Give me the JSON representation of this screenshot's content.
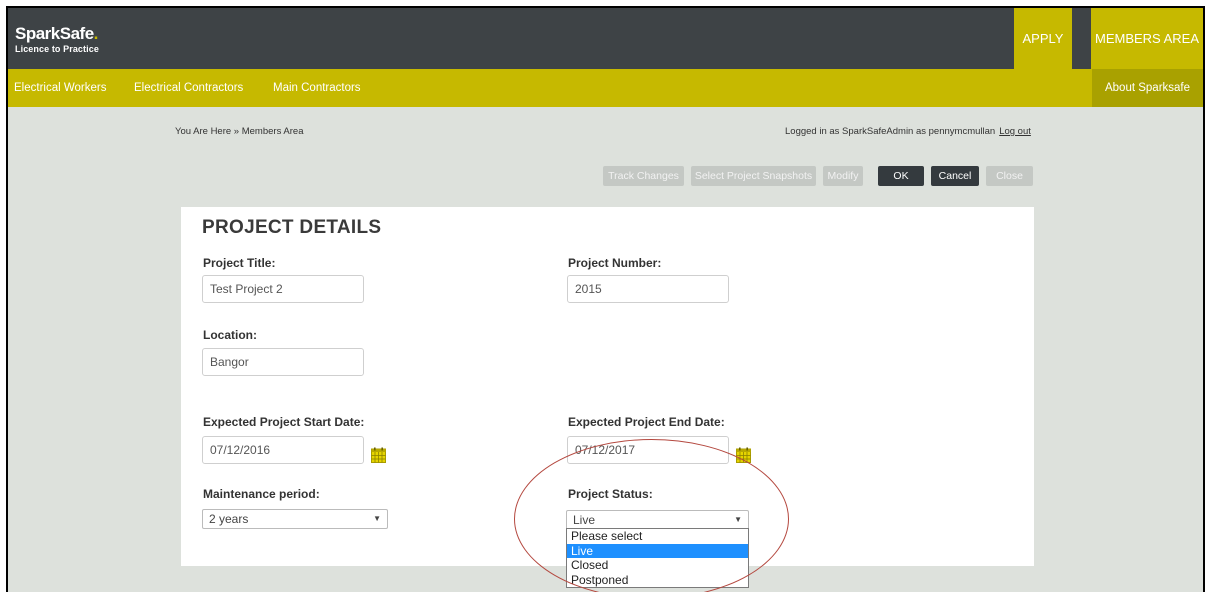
{
  "brand": {
    "name": "SparkSafe",
    "dot": ".",
    "tagline": "Licence to Practice"
  },
  "header": {
    "apply_label": "APPLY",
    "members_label": "MEMBERS AREA"
  },
  "nav": {
    "items": [
      "Electrical Workers",
      "Electrical Contractors",
      "Main Contractors"
    ],
    "about_label": "About Sparksafe"
  },
  "breadcrumb": "You Are Here » Members Area",
  "login": {
    "text": "Logged in as SparkSafeAdmin as pennymcmullan",
    "logout_label": "Log out"
  },
  "toolbar": {
    "track_changes": "Track Changes",
    "select_snapshots": "Select Project Snapshots",
    "modify": "Modify",
    "ok": "OK",
    "cancel": "Cancel",
    "close": "Close"
  },
  "form": {
    "title": "PROJECT DETAILS",
    "project_title_label": "Project Title:",
    "project_title_value": "Test Project 2",
    "project_number_label": "Project Number:",
    "project_number_value": "2015",
    "location_label": "Location:",
    "location_value": "Bangor",
    "start_date_label": "Expected Project Start Date:",
    "start_date_value": "07/12/2016",
    "end_date_label": "Expected Project End Date:",
    "end_date_value": "07/12/2017",
    "maintenance_label": "Maintenance period:",
    "maintenance_value": "2 years",
    "status_label": "Project Status:",
    "status_value": "Live",
    "status_options": [
      "Please select",
      "Live",
      "Closed",
      "Postponed"
    ]
  },
  "colors": {
    "brand_yellow": "#c6b900",
    "header_dark": "#3e4346",
    "annotation_red": "#b4483f",
    "selection_blue": "#1e90ff"
  },
  "icons": {
    "calendar": "calendar-icon",
    "dropdown_arrow": "chevron-down-icon"
  }
}
